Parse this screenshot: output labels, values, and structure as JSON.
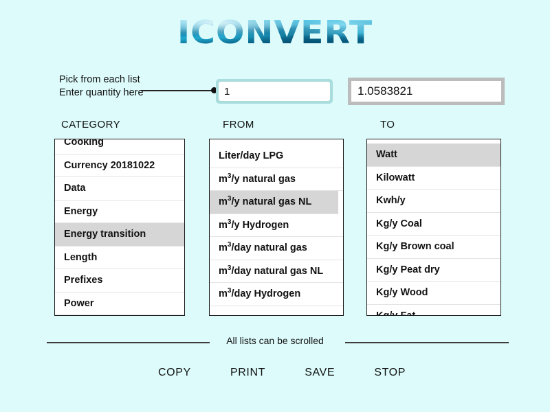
{
  "app": {
    "logo_text": "iConvert",
    "accent_color": "#1a9ec4",
    "background_color": "#ddfbfb",
    "selection_color": "#d6d6d6"
  },
  "instructions": {
    "text": "Pick from each list\nEnter quantity here"
  },
  "quantity": {
    "value": "1",
    "placeholder": ""
  },
  "result": {
    "value": "1.0583821",
    "placeholder": ""
  },
  "columns": {
    "category_label": "CATEGORY",
    "from_label": "FROM",
    "to_label": "TO"
  },
  "category_list": {
    "items": [
      {
        "label": "Cooking",
        "selected": false
      },
      {
        "label": "Currency 20181022",
        "selected": false
      },
      {
        "label": "Data",
        "selected": false
      },
      {
        "label": "Energy",
        "selected": false
      },
      {
        "label": "Energy transition",
        "selected": true
      },
      {
        "label": "Length",
        "selected": false
      },
      {
        "label": "Prefixes",
        "selected": false
      },
      {
        "label": "Power",
        "selected": false
      }
    ]
  },
  "from_list": {
    "items": [
      {
        "label": "Liter/day LPG",
        "selected": false
      },
      {
        "label": "m³/y natural gas",
        "selected": false
      },
      {
        "label": "m³/y natural gas NL",
        "selected": true
      },
      {
        "label": "m³/y Hydrogen",
        "selected": false
      },
      {
        "label": "m³/day natural gas",
        "selected": false
      },
      {
        "label": "m³/day natural gas NL",
        "selected": false
      },
      {
        "label": "m³/day Hydrogen",
        "selected": false
      }
    ]
  },
  "to_list": {
    "items": [
      {
        "label": "Watt",
        "selected": true
      },
      {
        "label": "Kilowatt",
        "selected": false
      },
      {
        "label": "Kwh/y",
        "selected": false
      },
      {
        "label": "Kg/y Coal",
        "selected": false
      },
      {
        "label": "Kg/y Brown coal",
        "selected": false
      },
      {
        "label": "Kg/y Peat dry",
        "selected": false
      },
      {
        "label": "Kg/y Wood",
        "selected": false
      },
      {
        "label": "Kg/y Fat",
        "selected": false
      }
    ]
  },
  "footer": {
    "note": "All lists can be scrolled",
    "buttons": [
      {
        "label": "COPY"
      },
      {
        "label": "PRINT"
      },
      {
        "label": "SAVE"
      },
      {
        "label": "STOP"
      }
    ]
  }
}
